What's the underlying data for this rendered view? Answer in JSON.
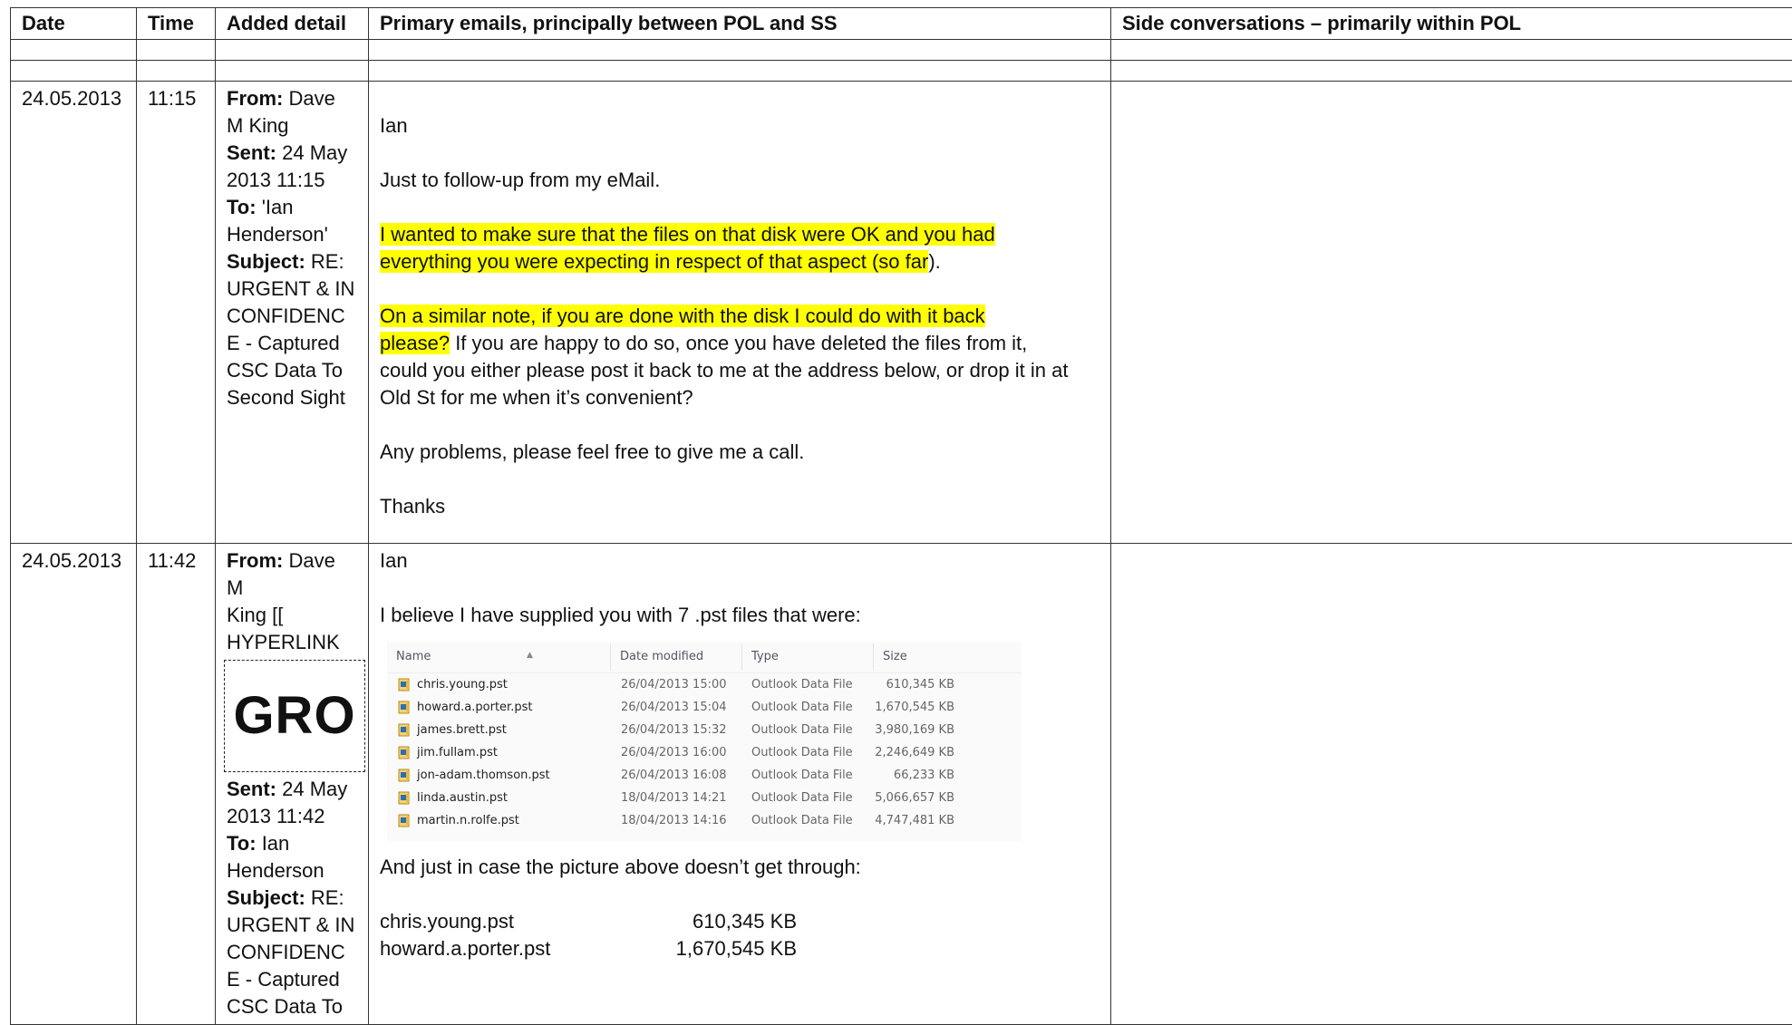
{
  "headers": {
    "date": "Date",
    "time": "Time",
    "detail": "Added detail",
    "primary": "Primary emails, principally between POL and SS",
    "side": "Side conversations – primarily within POL"
  },
  "row1": {
    "date": "24.05.2013",
    "time": "11:15",
    "meta": {
      "from_label": "From:",
      "from": " Dave M King",
      "sent_label": "Sent:",
      "sent": " 24 May 2013 11:15",
      "to_label": "To:",
      "to": " 'Ian Henderson'",
      "subject_label": "Subject:",
      "subject": " RE: URGENT & IN CONFIDENCE - Captured CSC Data To Second Sight"
    },
    "email": {
      "greeting": "Ian",
      "line1": "Just to follow-up from my eMail.",
      "hl1a": "I wanted to make sure that the files on that disk were OK and you had",
      "hl1b": "everything you were expecting in respect of that aspect (so far",
      "hl1b_tail": ").",
      "hl2a": "On a similar note, if you are done with the disk I could do with it back",
      "hl2b": "please?",
      "p2_tail": "  If you are happy to do so, once you have deleted the files from it,",
      "p2_l2": "could you either please post it back to me at the address below, or drop it in at",
      "p2_l3": "Old St for me when it’s convenient?",
      "line3": "Any problems, please feel free to give me a call.",
      "signoff": "Thanks"
    }
  },
  "row2": {
    "date": "24.05.2013",
    "time": "11:42",
    "meta": {
      "from_label": "From:",
      "from_a": " Dave M",
      "from_b": "King [[",
      "from_c": "HYPERLINK",
      "redaction": "GRO",
      "sent_label": "Sent:",
      "sent": " 24 May 2013 11:42",
      "to_label": "To:",
      "to": " Ian Henderson",
      "subject_label": "Subject:",
      "subject": " RE: URGENT & IN CONFIDENCE - Captured CSC Data To"
    },
    "email": {
      "greeting": "Ian",
      "line1": "I believe I have supplied you with 7 .pst files that were:",
      "after_pic": "And just in case the picture above doesn’t get through:"
    },
    "explorer": {
      "columns": {
        "name": "Name",
        "date": "Date modified",
        "type": "Type",
        "size": "Size"
      },
      "files": [
        {
          "name": "chris.young.pst",
          "date": "26/04/2013 15:00",
          "type": "Outlook Data File",
          "size": "610,345 KB"
        },
        {
          "name": "howard.a.porter.pst",
          "date": "26/04/2013 15:04",
          "type": "Outlook Data File",
          "size": "1,670,545 KB"
        },
        {
          "name": "james.brett.pst",
          "date": "26/04/2013 15:32",
          "type": "Outlook Data File",
          "size": "3,980,169 KB"
        },
        {
          "name": "jim.fullam.pst",
          "date": "26/04/2013 16:00",
          "type": "Outlook Data File",
          "size": "2,246,649 KB"
        },
        {
          "name": "jon-adam.thomson.pst",
          "date": "26/04/2013 16:08",
          "type": "Outlook Data File",
          "size": "66,233 KB"
        },
        {
          "name": "linda.austin.pst",
          "date": "18/04/2013 14:21",
          "type": "Outlook Data File",
          "size": "5,066,657 KB"
        },
        {
          "name": "martin.n.rolfe.pst",
          "date": "18/04/2013 14:16",
          "type": "Outlook Data File",
          "size": "4,747,481 KB"
        }
      ]
    },
    "text_list": [
      {
        "name": "chris.young.pst",
        "size": "610,345 KB"
      },
      {
        "name": "howard.a.porter.pst",
        "size": "1,670,545 KB"
      }
    ]
  }
}
